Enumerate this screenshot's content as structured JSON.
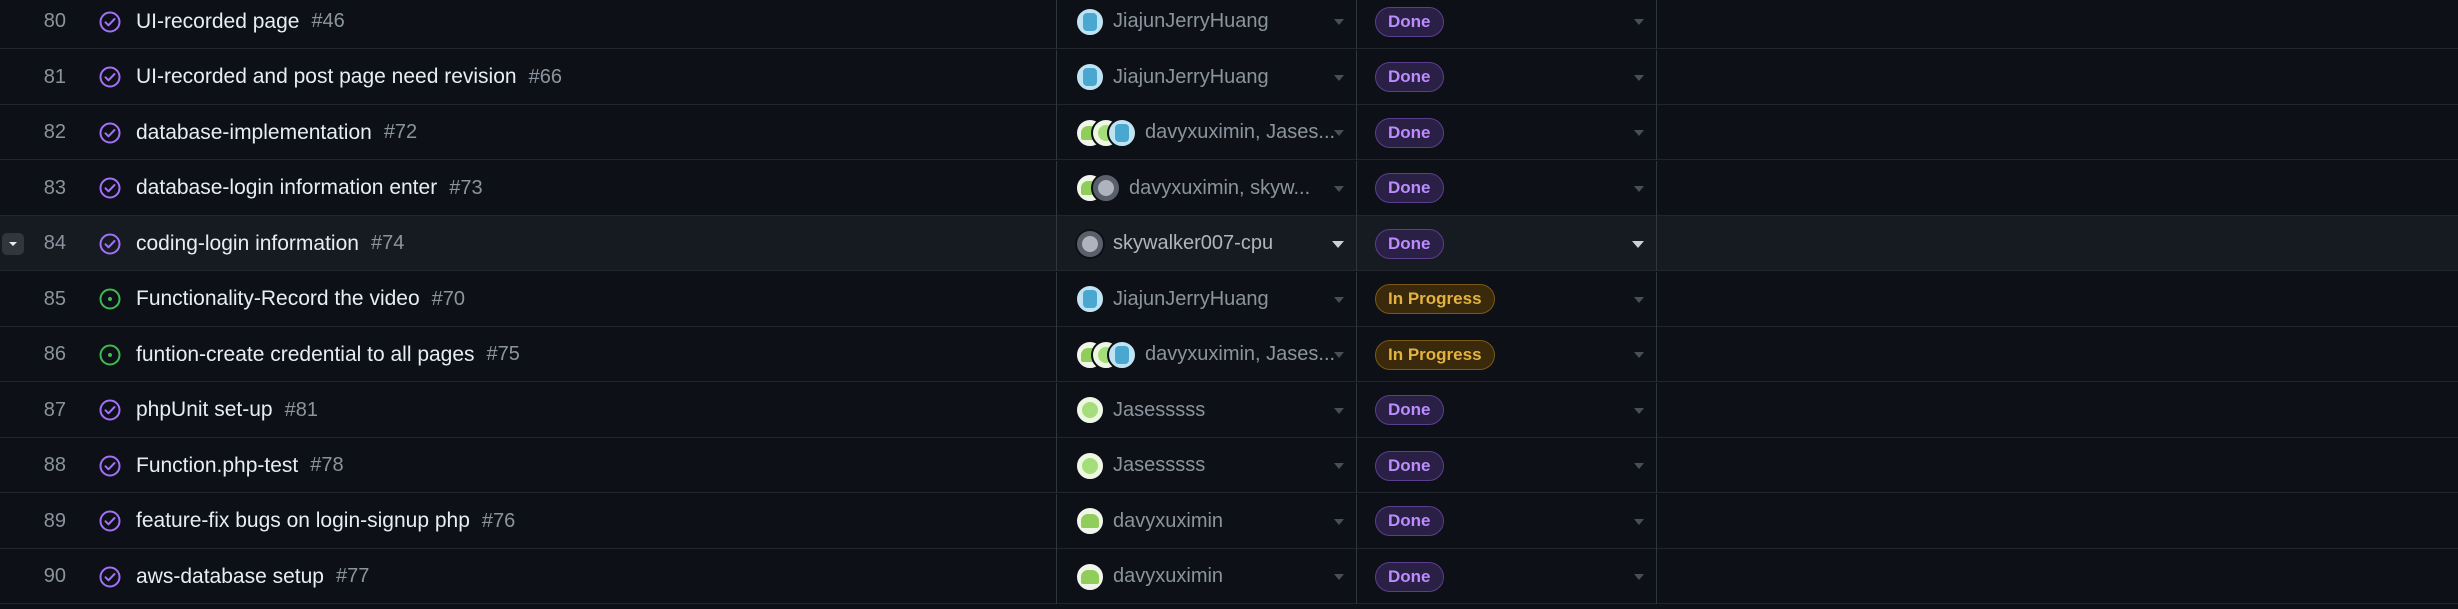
{
  "rows": [
    {
      "num": "80",
      "title": "UI-recorded page",
      "issue": "#46",
      "state": "closed",
      "assignees": [
        "jj"
      ],
      "assignee_text": "JiajunJerryHuang",
      "status": "Done"
    },
    {
      "num": "81",
      "title": "UI-recorded and post page need revision",
      "issue": "#66",
      "state": "closed",
      "assignees": [
        "jj"
      ],
      "assignee_text": "JiajunJerryHuang",
      "status": "Done"
    },
    {
      "num": "82",
      "title": "database-implementation",
      "issue": "#72",
      "state": "closed",
      "assignees": [
        "dx",
        "js",
        "jj"
      ],
      "assignee_text": "davyxuximin, Jases...",
      "status": "Done"
    },
    {
      "num": "83",
      "title": "database-login information enter",
      "issue": "#73",
      "state": "closed",
      "assignees": [
        "dx",
        "sk"
      ],
      "assignee_text": "davyxuximin, skyw...",
      "status": "Done"
    },
    {
      "num": "84",
      "title": "coding-login information",
      "issue": "#74",
      "state": "closed",
      "assignees": [
        "sk"
      ],
      "assignee_text": "skywalker007-cpu",
      "status": "Done"
    },
    {
      "num": "85",
      "title": "Functionality-Record the video",
      "issue": "#70",
      "state": "open",
      "assignees": [
        "jj"
      ],
      "assignee_text": "JiajunJerryHuang",
      "status": "In Progress"
    },
    {
      "num": "86",
      "title": "funtion-create credential to all pages",
      "issue": "#75",
      "state": "open",
      "assignees": [
        "dx",
        "js",
        "jj"
      ],
      "assignee_text": "davyxuximin, Jases...",
      "status": "In Progress"
    },
    {
      "num": "87",
      "title": "phpUnit set-up",
      "issue": "#81",
      "state": "closed",
      "assignees": [
        "js"
      ],
      "assignee_text": "Jasesssss",
      "status": "Done"
    },
    {
      "num": "88",
      "title": "Function.php-test",
      "issue": "#78",
      "state": "closed",
      "assignees": [
        "js"
      ],
      "assignee_text": "Jasesssss",
      "status": "Done"
    },
    {
      "num": "89",
      "title": "feature-fix bugs on login-signup php",
      "issue": "#76",
      "state": "closed",
      "assignees": [
        "dx"
      ],
      "assignee_text": "davyxuximin",
      "status": "Done"
    },
    {
      "num": "90",
      "title": "aws-database setup",
      "issue": "#77",
      "state": "closed",
      "assignees": [
        "dx"
      ],
      "assignee_text": "davyxuximin",
      "status": "Done"
    }
  ],
  "colors": {
    "background": "#0d1117",
    "closed_icon": "#a371f7",
    "open_icon": "#3fb950",
    "done_badge": "#bc8cff",
    "in_progress_badge": "#e3b341"
  },
  "icons": {
    "closed_state": "check-circle-icon",
    "open_state": "dot-circle-icon",
    "dropdown": "chevron-down-icon"
  }
}
